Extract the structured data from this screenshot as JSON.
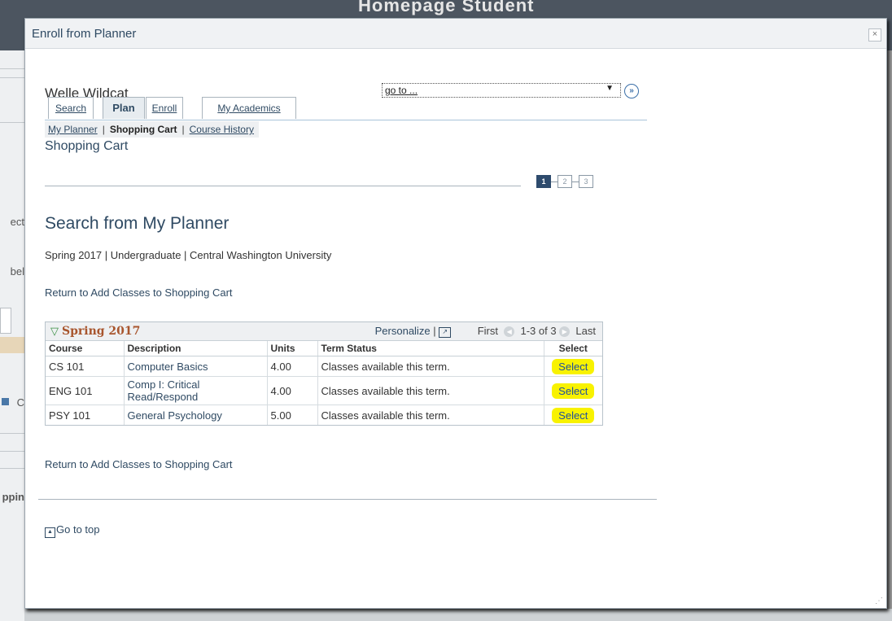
{
  "background": {
    "title": "Homepage Student",
    "left_fragments": [
      "ect",
      "bel",
      "C",
      "ppin"
    ]
  },
  "dialog": {
    "title": "Enroll from Planner",
    "close_label": "×"
  },
  "student_name": "Welle Wildcat",
  "goto": {
    "value": "go to ...",
    "button_label": "»"
  },
  "tabs": [
    {
      "label": "Search",
      "active": false
    },
    {
      "label": "Plan",
      "active": true
    },
    {
      "label": "Enroll",
      "active": false
    },
    {
      "label": "My Academics",
      "active": false
    }
  ],
  "subnav": {
    "my_planner": "My Planner",
    "shopping_cart": "Shopping Cart",
    "course_history": "Course History",
    "separator": "|"
  },
  "section_title": "Shopping Cart",
  "steps": [
    "1",
    "2",
    "3"
  ],
  "page_title": "Search from My Planner",
  "term_line": "Spring 2017 | Undergraduate | Central Washington University",
  "return_link": "Return to Add Classes to Shopping Cart",
  "grid": {
    "title": "Spring 2017",
    "personalize": "Personalize",
    "separator": "|",
    "first": "First",
    "range": "1-3 of 3",
    "last": "Last",
    "columns": [
      "Course",
      "Description",
      "Units",
      "Term Status",
      "Select"
    ],
    "rows": [
      {
        "course": "CS 101",
        "description": "Computer Basics",
        "units": "4.00",
        "status": "Classes available this term.",
        "select": "Select"
      },
      {
        "course": "ENG 101",
        "description": "Comp I: Critical Read/Respond",
        "units": "4.00",
        "status": "Classes available this term.",
        "select": "Select"
      },
      {
        "course": "PSY 101",
        "description": "General Psychology",
        "units": "5.00",
        "status": "Classes available this term.",
        "select": "Select"
      }
    ]
  },
  "go_to_top": "Go to top",
  "colors": {
    "link": "#2f4a63",
    "highlight": "#f8f200",
    "grid_title": "#a8552d",
    "current_step": "#2e4b6d"
  }
}
